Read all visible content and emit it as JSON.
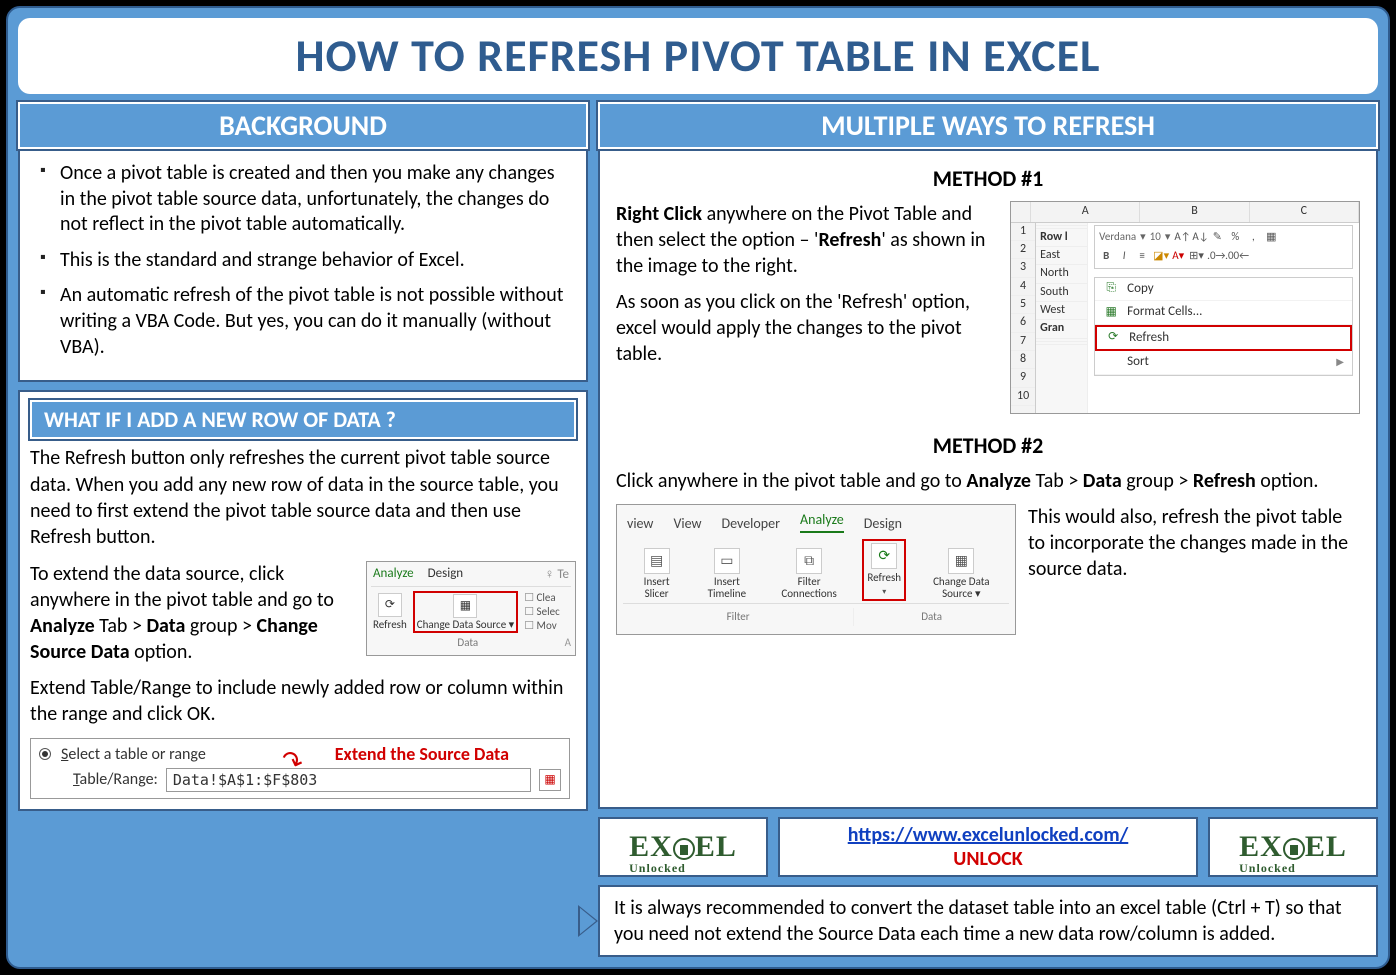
{
  "title": "HOW TO REFRESH PIVOT TABLE IN EXCEL",
  "left": {
    "background_header": "BACKGROUND",
    "bg_items": [
      "Once a pivot table is created and then you make any changes in the pivot table source data, unfortunately, the changes do not reflect in the pivot table automatically.",
      "This is the standard and strange behavior of Excel.",
      "An automatic refresh of the pivot table is not possible without writing a VBA Code. But yes, you can do it manually (without VBA)."
    ],
    "whatif_header": "WHAT IF I ADD A NEW ROW OF DATA ?",
    "whatif_p1": "The Refresh button only refreshes the current pivot table source data. When you add any new row of data in the source table, you need to first extend the pivot table source data and then use Refresh button.",
    "whatif_p2_pre": "To extend the data source, click anywhere in the pivot table and go to ",
    "whatif_p2_b1": "Analyze",
    "whatif_p2_mid1": " Tab > ",
    "whatif_p2_b2": "Data",
    "whatif_p2_mid2": " group > ",
    "whatif_p2_b3": "Change Source Data",
    "whatif_p2_post": " option.",
    "whatif_p3": "Extend Table/Range to include newly added row or column within the range and click OK.",
    "mock_small_ribbon": {
      "tabs": [
        "Analyze",
        "Design"
      ],
      "tell": "♀ Te",
      "btn_refresh": "Refresh",
      "btn_change": "Change Data Source ▾",
      "side": [
        "Clea",
        "Selec",
        "Mov"
      ],
      "group": "Data",
      "corner": "A"
    },
    "mock_range": {
      "radio_label": "Select a table or range",
      "field_label": "Table/Range:",
      "value": "Data!$A$1:$F$803",
      "annot": "Extend the Source Data"
    }
  },
  "right": {
    "header": "MULTIPLE WAYS TO REFRESH",
    "method1_label": "METHOD #1",
    "m1_p1_a": "Right Click",
    "m1_p1_b": " anywhere on the Pivot Table and then select the option – '",
    "m1_p1_c": "Refresh",
    "m1_p1_d": "' as shown in the image to the right.",
    "m1_p2": "As soon as you click on the 'Refresh' option, excel would apply the changes to the pivot table.",
    "mock_ctx": {
      "cols": [
        "A",
        "B",
        "C"
      ],
      "rownums": [
        "1",
        "2",
        "3",
        "4",
        "5",
        "6",
        "7",
        "8",
        "9",
        "10"
      ],
      "colA": [
        "",
        "",
        "Row l",
        "East",
        "North",
        "South",
        "West",
        "Gran",
        "",
        ""
      ],
      "minitool_font": "Verdana",
      "minitool_size": "10",
      "menu": [
        "Copy",
        "Format Cells...",
        "Refresh",
        "Sort"
      ]
    },
    "method2_label": "METHOD #2",
    "m2_p1_a": "Click anywhere in the pivot table and go to ",
    "m2_p1_b": "Analyze",
    "m2_p1_c": " Tab > ",
    "m2_p1_d": "Data",
    "m2_p1_e": " group > ",
    "m2_p1_f": "Refresh",
    "m2_p1_g": " option.",
    "m2_p2": "This would also, refresh the pivot table to incorporate the changes made in the source data.",
    "mock_ribbon": {
      "tabs": [
        "view",
        "View",
        "Developer",
        "Analyze",
        "Design"
      ],
      "btns": [
        "Insert Slicer",
        "Insert Timeline",
        "Filter Connections",
        "Refresh",
        "Change Data Source ▾"
      ],
      "groups": [
        "Filter",
        "Data"
      ]
    }
  },
  "footer": {
    "logo_main": "EXCEL",
    "logo_sub": "Unlocked",
    "url": "https://www.excelunlocked.com/",
    "unlock": "UNLOCK",
    "tip": "It is always recommended to convert the dataset table into an excel table (Ctrl + T) so that you need not extend the Source Data each time a new data row/column is added."
  }
}
